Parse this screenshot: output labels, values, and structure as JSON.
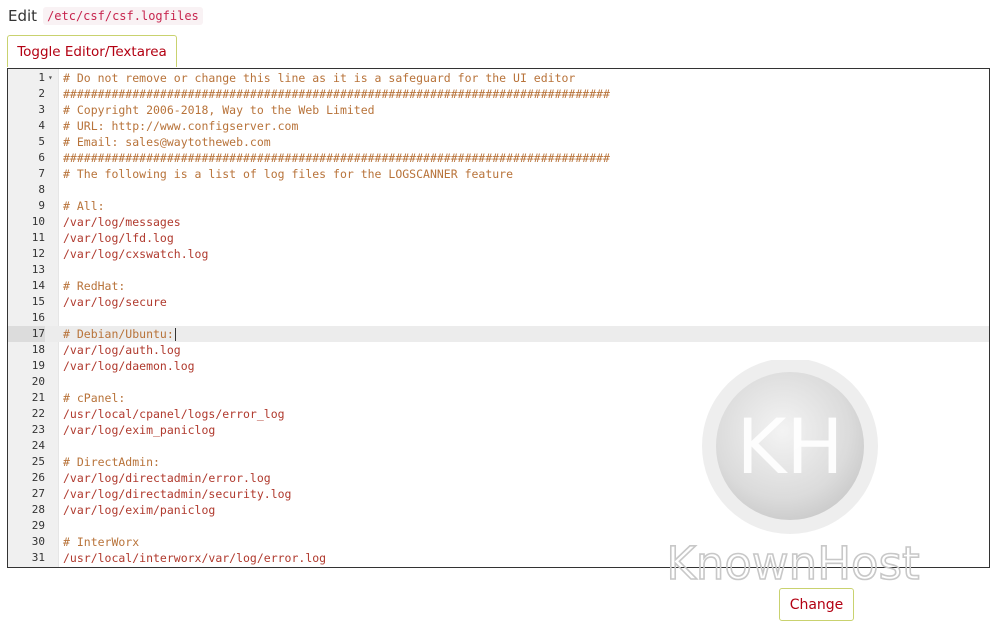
{
  "header": {
    "edit_label": "Edit",
    "file_path": "/etc/csf/csf.logfiles"
  },
  "toolbar": {
    "toggle_label": "Toggle Editor/Textarea"
  },
  "editor": {
    "active_line": 17,
    "lines": [
      {
        "n": "1",
        "text": "# Do not remove or change this line as it is a safeguard for the UI editor",
        "kind": "comment",
        "fold": true
      },
      {
        "n": "2",
        "text": "###############################################################################",
        "kind": "comment"
      },
      {
        "n": "3",
        "text": "# Copyright 2006-2018, Way to the Web Limited",
        "kind": "comment"
      },
      {
        "n": "4",
        "text": "# URL: http://www.configserver.com",
        "kind": "comment"
      },
      {
        "n": "5",
        "text": "# Email: sales@waytotheweb.com",
        "kind": "comment"
      },
      {
        "n": "6",
        "text": "###############################################################################",
        "kind": "comment"
      },
      {
        "n": "7",
        "text": "# The following is a list of log files for the LOGSCANNER feature",
        "kind": "comment"
      },
      {
        "n": "8",
        "text": "",
        "kind": "blank"
      },
      {
        "n": "9",
        "text": "# All:",
        "kind": "comment"
      },
      {
        "n": "10",
        "text": "/var/log/messages",
        "kind": "path"
      },
      {
        "n": "11",
        "text": "/var/log/lfd.log",
        "kind": "path"
      },
      {
        "n": "12",
        "text": "/var/log/cxswatch.log",
        "kind": "path"
      },
      {
        "n": "13",
        "text": "",
        "kind": "blank"
      },
      {
        "n": "14",
        "text": "# RedHat:",
        "kind": "comment"
      },
      {
        "n": "15",
        "text": "/var/log/secure",
        "kind": "path"
      },
      {
        "n": "16",
        "text": "",
        "kind": "blank"
      },
      {
        "n": "17",
        "text": "# Debian/Ubuntu:",
        "kind": "comment"
      },
      {
        "n": "18",
        "text": "/var/log/auth.log",
        "kind": "path"
      },
      {
        "n": "19",
        "text": "/var/log/daemon.log",
        "kind": "path"
      },
      {
        "n": "20",
        "text": "",
        "kind": "blank"
      },
      {
        "n": "21",
        "text": "# cPanel:",
        "kind": "comment"
      },
      {
        "n": "22",
        "text": "/usr/local/cpanel/logs/error_log",
        "kind": "path"
      },
      {
        "n": "23",
        "text": "/var/log/exim_paniclog",
        "kind": "path"
      },
      {
        "n": "24",
        "text": "",
        "kind": "blank"
      },
      {
        "n": "25",
        "text": "# DirectAdmin:",
        "kind": "comment"
      },
      {
        "n": "26",
        "text": "/var/log/directadmin/error.log",
        "kind": "path"
      },
      {
        "n": "27",
        "text": "/var/log/directadmin/security.log",
        "kind": "path"
      },
      {
        "n": "28",
        "text": "/var/log/exim/paniclog",
        "kind": "path"
      },
      {
        "n": "29",
        "text": "",
        "kind": "blank"
      },
      {
        "n": "30",
        "text": "# InterWorx",
        "kind": "comment"
      },
      {
        "n": "31",
        "text": "/usr/local/interworx/var/log/error.log",
        "kind": "path"
      }
    ]
  },
  "footer": {
    "change_label": "Change"
  },
  "watermark": {
    "brand_text": "KnownHost",
    "logo_letters": "KH"
  },
  "colors": {
    "button_text": "#b30012",
    "button_border": "#c9d26f",
    "code_text": "#c0392b"
  }
}
